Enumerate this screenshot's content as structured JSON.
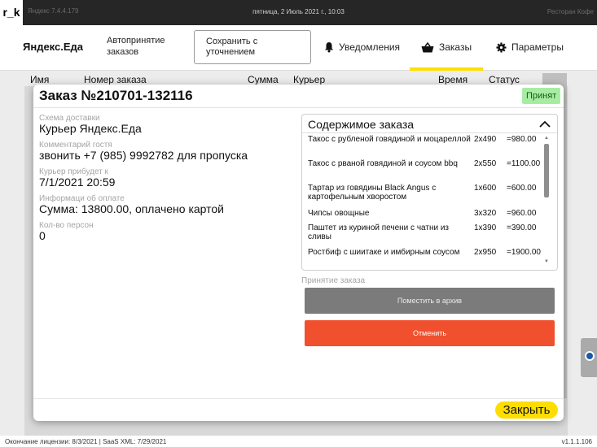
{
  "system_bar": {
    "logo": "r_k",
    "left_text": "Яндекс 7.4.4.179",
    "datetime": "пятница, 2 Июль 2021 г., 10:03",
    "right_text": "Ресторан Кофе"
  },
  "nav": {
    "brand": "Яндекс.Еда",
    "auto_accept": "Автопринятие заказов",
    "save_with_clarification": "Сохранить с уточнением",
    "notifications": "Уведомления",
    "orders": "Заказы",
    "settings": "Параметры",
    "accent_color": "#ffe000"
  },
  "table_header": {
    "name": "Имя",
    "order_number": "Номер заказа",
    "sum": "Сумма",
    "courier": "Курьер",
    "time": "Время",
    "status": "Статус"
  },
  "modal": {
    "title": "Заказ №210701-132116",
    "status": "Принят",
    "fields": [
      {
        "label": "Схема доставки",
        "value": "Курьер Яндекс.Еда"
      },
      {
        "label": "Комментарий гостя",
        "value": "звонить +7 (985) 9992782 для пропуска"
      },
      {
        "label": "Курьер прибудет к",
        "value": "7/1/2021 20:59"
      },
      {
        "label": "Информаци об оплате",
        "value": "Сумма: 13800.00, оплачено картой"
      },
      {
        "label": "Кол-во персон",
        "value": "0"
      }
    ],
    "contents_title": "Содержимое заказа",
    "items": [
      {
        "name": "Такос с рубленой говядиной и моцареллой",
        "qty": "2x490",
        "sum": "=980.00"
      },
      {
        "name": "Такос с рваной говядиной и соусом bbq",
        "qty": "2x550",
        "sum": "=1100.00"
      },
      {
        "name": "Тартар из говядины Black Angus с картофельным хворостом",
        "qty": "1x600",
        "sum": "=600.00"
      },
      {
        "name": "Чипсы овощные",
        "qty": "3x320",
        "sum": "=960.00"
      },
      {
        "name": "Паштет из куриной печени с чатни из сливы",
        "qty": "1x390",
        "sum": "=390.00"
      },
      {
        "name": "Ростбиф с шиитаке и имбирным соусом",
        "qty": "2x950",
        "sum": "=1900.00"
      }
    ],
    "accept_section_label": "Принятие заказа",
    "archive_button": "Поместить в архив",
    "cancel_button": "Отменить",
    "close_button": "Закрыть"
  },
  "footer": {
    "license": "Окончание лицензии: 8/3/2021   |   SaaS XML: 7/29/2021",
    "version": "v1.1.1.106"
  },
  "colors": {
    "status_bg": "#a6eda3",
    "cancel": "#f0502e",
    "close": "#ffdd00",
    "archive": "#7b7b7b"
  }
}
